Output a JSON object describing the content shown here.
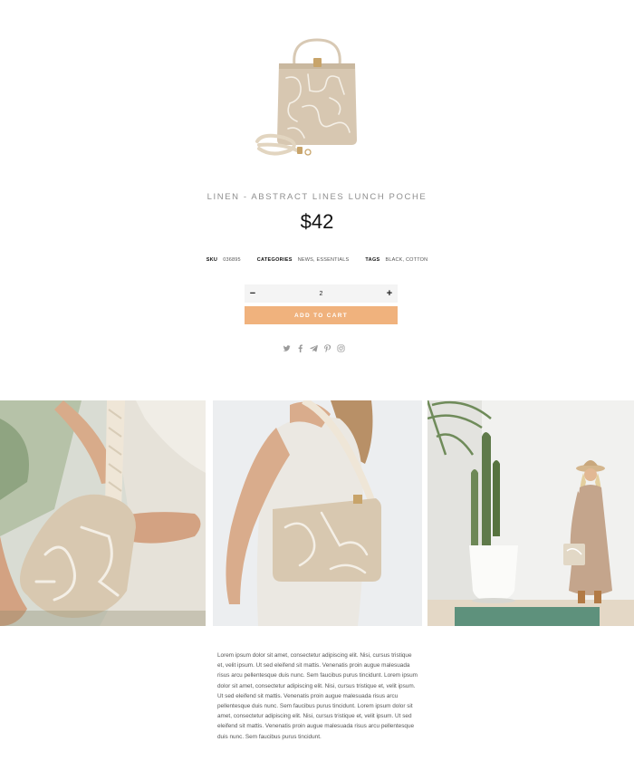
{
  "product": {
    "title": "LINEN - ABSTRACT LINES LUNCH POCHE",
    "price": "$42",
    "meta": {
      "sku_label": "SKU",
      "sku_value": "036895",
      "categories_label": "CATEGORIES",
      "categories_value": "NEWS, ESSENTIALS",
      "tags_label": "TAGS",
      "tags_value": "BLACK, COTTON"
    }
  },
  "cart": {
    "quantity": "2",
    "minus_label": "−",
    "plus_label": "+",
    "add_to_cart_label": "ADD TO CART"
  },
  "share_icons": [
    "twitter-icon",
    "facebook-icon",
    "telegram-icon",
    "pinterest-icon",
    "instagram-icon"
  ],
  "gallery": [
    {
      "name": "gallery-photo-closeup"
    },
    {
      "name": "gallery-photo-shoulder"
    },
    {
      "name": "gallery-photo-fullbody"
    }
  ],
  "description": "Lorem ipsum dolor sit amet, consectetur adipiscing elit. Nisi, cursus tristique et, velit ipsum. Ut sed eleifend sit mattis. Venenatis proin augue malesuada risus arcu pellentesque duis nunc. Sem faucibus purus tincidunt. Lorem ipsum dolor sit amet, consectetur adipiscing elit. Nisi, cursus tristique et, velit ipsum. Ut sed eleifend sit mattis. Venenatis proin augue malesuada risus arcu pellentesque duis nunc. Sem faucibus purus tincidunt. Lorem ipsum dolor sit amet, consectetur adipiscing elit. Nisi, cursus tristique et, velit ipsum. Ut sed eleifend sit mattis. Venenatis proin augue malesuada risus arcu pellentesque duis nunc. Sem faucibus purus tincidunt.",
  "colors": {
    "accent": "#f0b27d",
    "title_gray": "#8f8f8f",
    "qty_background": "#f4f4f4",
    "icon_gray": "#9a9a9a"
  }
}
